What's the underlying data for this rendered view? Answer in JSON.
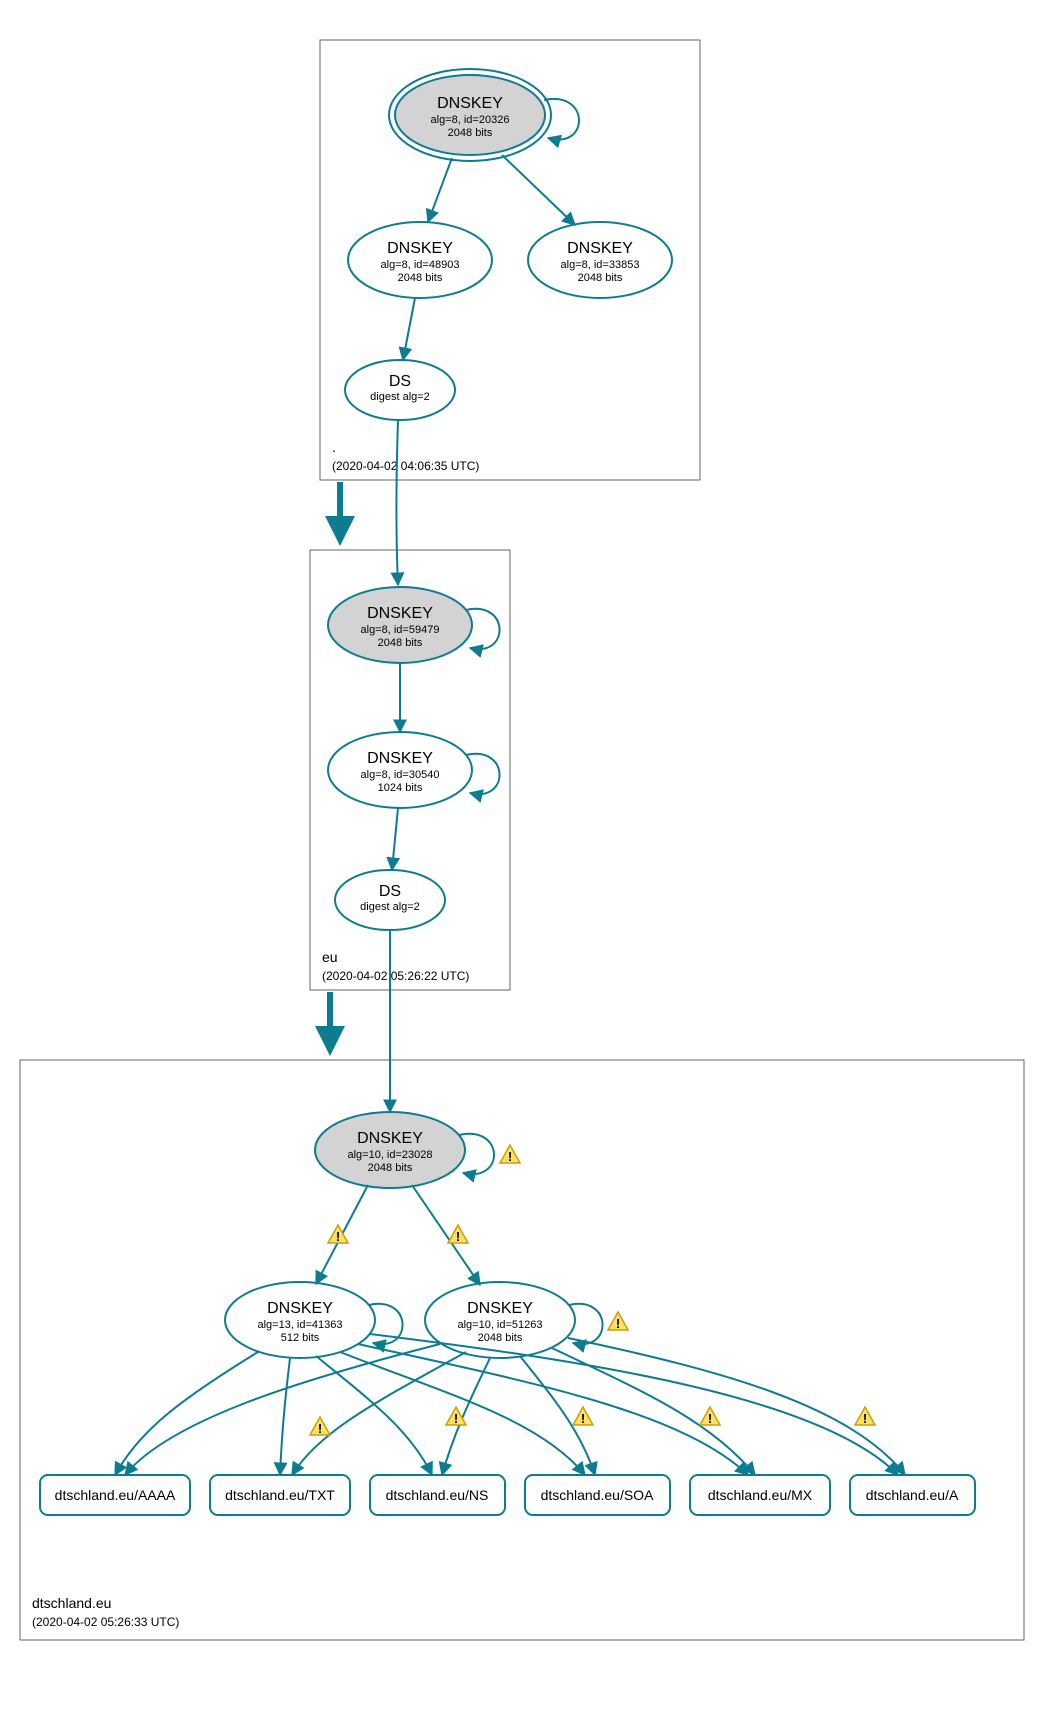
{
  "colors": {
    "accent": "#0d7c91",
    "node_fill_gray": "#d3d3d3",
    "warning_fill": "#ffe066",
    "warning_stroke": "#c8a000",
    "box_stroke": "#666666"
  },
  "zones": [
    {
      "id": "root",
      "label": ".",
      "timestamp": "(2020-04-02 04:06:35 UTC)",
      "nodes": [
        {
          "id": "root_ksk",
          "type": "dnskey",
          "title": "DNSKEY",
          "line2": "alg=8, id=20326",
          "line3": "2048 bits",
          "filled": true,
          "double_border": true,
          "self_loop": true
        },
        {
          "id": "root_zsk1",
          "type": "dnskey",
          "title": "DNSKEY",
          "line2": "alg=8, id=48903",
          "line3": "2048 bits",
          "filled": false,
          "self_loop": false
        },
        {
          "id": "root_zsk2",
          "type": "dnskey",
          "title": "DNSKEY",
          "line2": "alg=8, id=33853",
          "line3": "2048 bits",
          "filled": false,
          "self_loop": false
        },
        {
          "id": "root_ds",
          "type": "ds",
          "title": "DS",
          "line2": "digest alg=2"
        }
      ],
      "edges": [
        {
          "from": "root_ksk",
          "to": "root_zsk1"
        },
        {
          "from": "root_ksk",
          "to": "root_zsk2"
        },
        {
          "from": "root_zsk1",
          "to": "root_ds"
        }
      ]
    },
    {
      "id": "eu",
      "label": "eu",
      "timestamp": "(2020-04-02 05:26:22 UTC)",
      "nodes": [
        {
          "id": "eu_ksk",
          "type": "dnskey",
          "title": "DNSKEY",
          "line2": "alg=8, id=59479",
          "line3": "2048 bits",
          "filled": true,
          "self_loop": true
        },
        {
          "id": "eu_zsk",
          "type": "dnskey",
          "title": "DNSKEY",
          "line2": "alg=8, id=30540",
          "line3": "1024 bits",
          "filled": false,
          "self_loop": true
        },
        {
          "id": "eu_ds",
          "type": "ds",
          "title": "DS",
          "line2": "digest alg=2"
        }
      ],
      "edges": [
        {
          "from": "root_ds",
          "to": "eu_ksk",
          "crosses_zone": true
        },
        {
          "from": "eu_ksk",
          "to": "eu_zsk"
        },
        {
          "from": "eu_zsk",
          "to": "eu_ds"
        }
      ]
    },
    {
      "id": "dtschland",
      "label": "dtschland.eu",
      "timestamp": "(2020-04-02 05:26:33 UTC)",
      "nodes": [
        {
          "id": "d_ksk",
          "type": "dnskey",
          "title": "DNSKEY",
          "line2": "alg=10, id=23028",
          "line3": "2048 bits",
          "filled": true,
          "self_loop": true,
          "self_loop_warning": true
        },
        {
          "id": "d_zsk1",
          "type": "dnskey",
          "title": "DNSKEY",
          "line2": "alg=13, id=41363",
          "line3": "512 bits",
          "filled": false,
          "self_loop": true
        },
        {
          "id": "d_zsk2",
          "type": "dnskey",
          "title": "DNSKEY",
          "line2": "alg=10, id=51263",
          "line3": "2048 bits",
          "filled": false,
          "self_loop": true,
          "self_loop_warning": true
        },
        {
          "id": "rr_aaaa",
          "type": "record",
          "title": "dtschland.eu/AAAA"
        },
        {
          "id": "rr_txt",
          "type": "record",
          "title": "dtschland.eu/TXT"
        },
        {
          "id": "rr_ns",
          "type": "record",
          "title": "dtschland.eu/NS"
        },
        {
          "id": "rr_soa",
          "type": "record",
          "title": "dtschland.eu/SOA"
        },
        {
          "id": "rr_mx",
          "type": "record",
          "title": "dtschland.eu/MX"
        },
        {
          "id": "rr_a",
          "type": "record",
          "title": "dtschland.eu/A"
        }
      ],
      "edges": [
        {
          "from": "eu_ds",
          "to": "d_ksk",
          "crosses_zone": true
        },
        {
          "from": "d_ksk",
          "to": "d_zsk1",
          "warning": true
        },
        {
          "from": "d_ksk",
          "to": "d_zsk2",
          "warning": true
        },
        {
          "from": "d_zsk1",
          "to": "rr_aaaa"
        },
        {
          "from": "d_zsk1",
          "to": "rr_txt"
        },
        {
          "from": "d_zsk1",
          "to": "rr_ns"
        },
        {
          "from": "d_zsk1",
          "to": "rr_soa"
        },
        {
          "from": "d_zsk1",
          "to": "rr_mx"
        },
        {
          "from": "d_zsk1",
          "to": "rr_a"
        },
        {
          "from": "d_zsk2",
          "to": "rr_aaaa",
          "warning": true
        },
        {
          "from": "d_zsk2",
          "to": "rr_txt",
          "warning": true
        },
        {
          "from": "d_zsk2",
          "to": "rr_ns",
          "warning": true
        },
        {
          "from": "d_zsk2",
          "to": "rr_soa",
          "warning": true
        },
        {
          "from": "d_zsk2",
          "to": "rr_mx",
          "warning": true
        },
        {
          "from": "d_zsk2",
          "to": "rr_a",
          "warning": true
        }
      ]
    }
  ],
  "zone_transitions": [
    {
      "from_zone": "root",
      "to_zone": "eu"
    },
    {
      "from_zone": "eu",
      "to_zone": "dtschland"
    }
  ]
}
